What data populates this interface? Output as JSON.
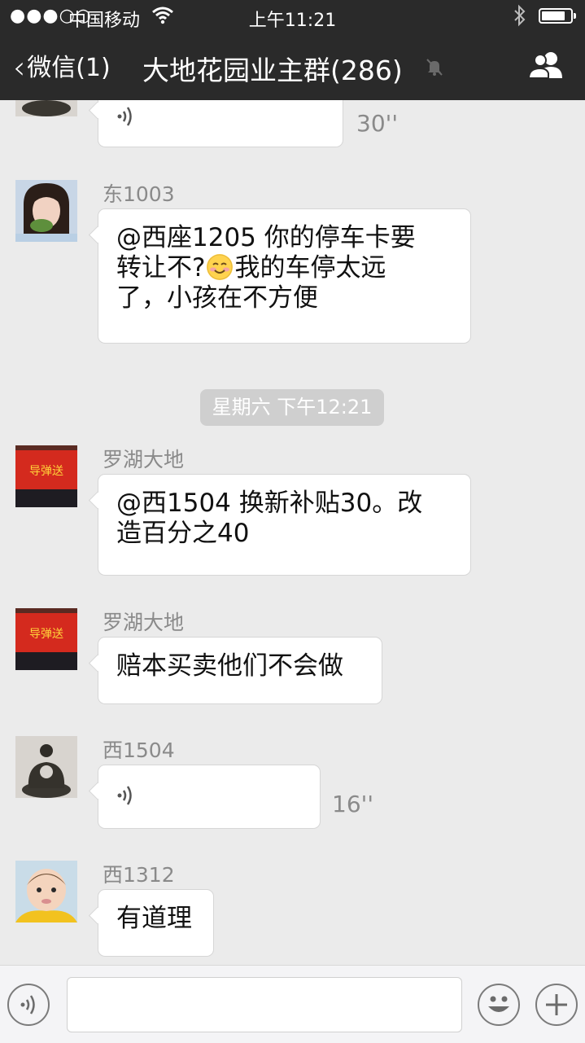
{
  "status_bar": {
    "signal": "●●●○○",
    "carrier": "中国移动",
    "time": "上午11:21"
  },
  "nav": {
    "back_label": "微信(1)",
    "title": "大地花园业主群(286)"
  },
  "messages": [
    {
      "type": "voice",
      "duration": "30''"
    },
    {
      "sender": "东1003",
      "lines": [
        "@西座1205 你的停车卡要",
        "转让不?",
        "我的车停太远",
        "了，小孩在不方便"
      ]
    },
    {
      "timestamp": "星期六 下午12:21"
    },
    {
      "sender": "罗湖大地",
      "lines": [
        "@西1504 换新补贴30。改",
        "造百分之40"
      ],
      "avatar_text": "导弹送"
    },
    {
      "sender": "罗湖大地",
      "text": "赔本买卖他们不会做",
      "avatar_text": "导弹送"
    },
    {
      "sender": "西1504",
      "type": "voice",
      "duration": "16''"
    },
    {
      "sender": "西1312",
      "text": "有道理"
    }
  ],
  "colors": {
    "header_bg": "#2a2a2a",
    "chat_bg": "#ebebeb",
    "bubble_bg": "#ffffff",
    "timestamp_bg": "#cfcfcf"
  }
}
